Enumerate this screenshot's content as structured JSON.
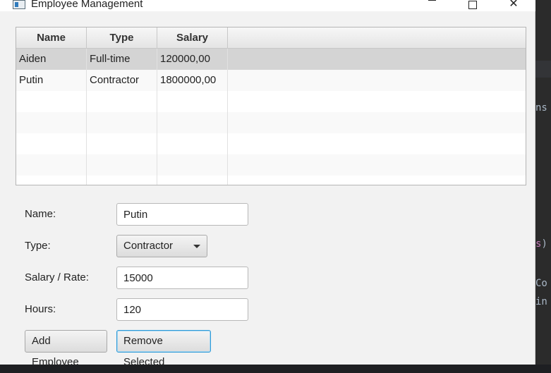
{
  "window": {
    "title": "Employee Management"
  },
  "table": {
    "columns": [
      "Name",
      "Type",
      "Salary"
    ],
    "rows": [
      {
        "name": "Aiden",
        "type": "Full-time",
        "salary": "120000,00",
        "selected": true
      },
      {
        "name": "Putin",
        "type": "Contractor",
        "salary": "1800000,00",
        "selected": false
      }
    ]
  },
  "form": {
    "name_label": "Name:",
    "name_value": "Putin",
    "type_label": "Type:",
    "type_value": "Contractor",
    "salary_label": "Salary / Rate:",
    "salary_value": "15000",
    "hours_label": "Hours:",
    "hours_value": "120",
    "add_label": "Add Employee",
    "remove_label": "Remove Selected"
  },
  "background_editor": {
    "fragments": [
      "ns",
      "s)",
      "Co",
      "in"
    ]
  },
  "colors": {
    "focus_border": "#2e9bd8",
    "selected_row": "#d4d4d4",
    "window_bg": "#f2f2f2"
  }
}
